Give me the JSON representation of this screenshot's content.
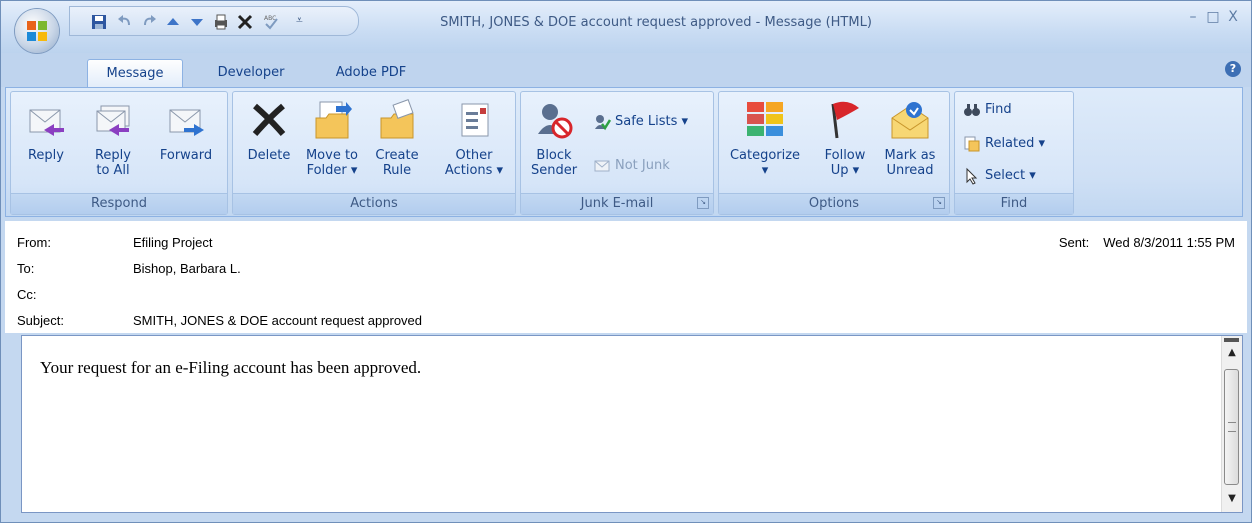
{
  "window": {
    "title": "SMITH, JONES & DOE account request approved - Message (HTML)",
    "min_glyph": "–",
    "max_glyph": "□",
    "close_glyph": "X",
    "qat_more_glyph": "⩡"
  },
  "tabs": [
    {
      "label": "Message",
      "active": true
    },
    {
      "label": "Developer",
      "active": false
    },
    {
      "label": "Adobe PDF",
      "active": false
    }
  ],
  "help_glyph": "?",
  "ribbon": {
    "respond": {
      "label": "Respond",
      "reply": "Reply",
      "reply_all_1": "Reply",
      "reply_all_2": "to All",
      "forward": "Forward"
    },
    "actions": {
      "label": "Actions",
      "delete": "Delete",
      "move_1": "Move to",
      "move_2": "Folder ▾",
      "create_1": "Create",
      "create_2": "Rule",
      "other_1": "Other",
      "other_2": "Actions ▾"
    },
    "junk": {
      "label": "Junk E-mail",
      "block_1": "Block",
      "block_2": "Sender",
      "safe_lists": "Safe Lists ▾",
      "not_junk": "Not Junk"
    },
    "options": {
      "label": "Options",
      "categorize_1": "Categorize",
      "categorize_2": "▾",
      "follow_1": "Follow",
      "follow_2": "Up ▾",
      "mark_1": "Mark as",
      "mark_2": "Unread"
    },
    "find": {
      "label": "Find",
      "find": "Find",
      "related": "Related ▾",
      "select": "Select ▾"
    }
  },
  "header": {
    "from_label": "From:",
    "from_value": "Efiling Project",
    "to_label": "To:",
    "to_value": "Bishop, Barbara L.",
    "cc_label": "Cc:",
    "cc_value": "",
    "subject_label": "Subject:",
    "subject_value": "SMITH, JONES & DOE account request approved",
    "sent_label": "Sent:",
    "sent_value": "Wed 8/3/2011 1:55 PM"
  },
  "body": {
    "text": "Your request for an e-Filing account has been approved."
  },
  "colors": {
    "ribbon_text": "#15428b",
    "ribbon_bg": "#cfe0f5"
  }
}
